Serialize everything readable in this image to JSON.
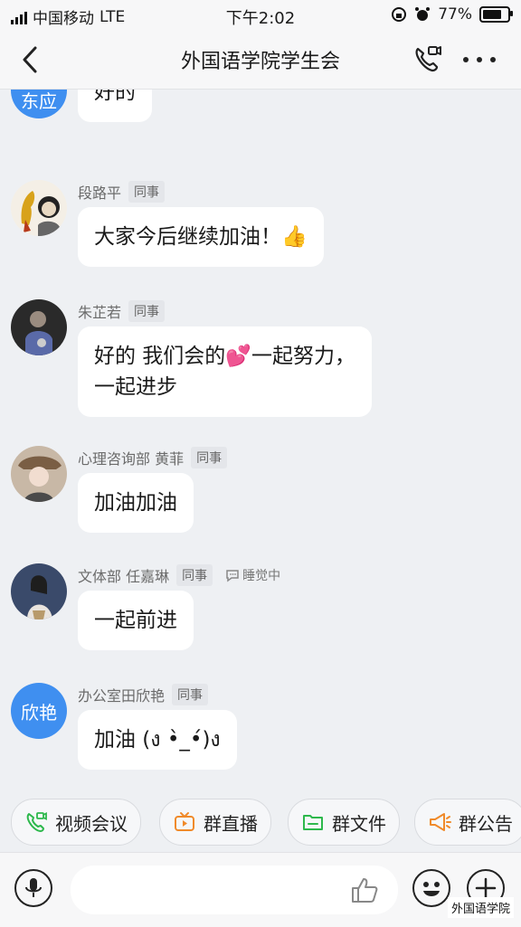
{
  "status_bar": {
    "carrier": "中国移动",
    "network": "LTE",
    "time": "下午2:02",
    "battery": "77%"
  },
  "header": {
    "title": "外国语学院学生会",
    "back_icon": "chevron-left-icon",
    "call_icon": "phone-video-icon",
    "more_icon": "more-dots-icon"
  },
  "messages": [
    {
      "avatar_text": "东应",
      "text": "好的"
    },
    {
      "name": "段路平",
      "tag": "同事",
      "text": "大家今后继续加油！👍"
    },
    {
      "name": "朱芷若",
      "tag": "同事",
      "text_line1": "好的 我们会的💕一起努力，",
      "text_line2": "一起进步"
    },
    {
      "name": "心理咨询部 黄菲",
      "tag": "同事",
      "text": "加油加油"
    },
    {
      "name": "文体部 任嘉琳",
      "tag": "同事",
      "status": "睡觉中",
      "text": "一起前进"
    },
    {
      "name": "办公室田欣艳",
      "tag": "同事",
      "avatar_text": "欣艳",
      "text": "加油 (ง •̀_•́)ง"
    }
  ],
  "quick_actions": [
    {
      "label": "视频会议",
      "icon": "video-call-icon"
    },
    {
      "label": "群直播",
      "icon": "live-tv-icon"
    },
    {
      "label": "群文件",
      "icon": "folder-icon"
    },
    {
      "label": "群公告",
      "icon": "megaphone-icon"
    }
  ],
  "input_bar": {
    "placeholder": ""
  },
  "watermark": "外国语学院",
  "colors": {
    "accent": "#3f8ff0",
    "green": "#2db84c",
    "orange": "#f08a2a"
  }
}
